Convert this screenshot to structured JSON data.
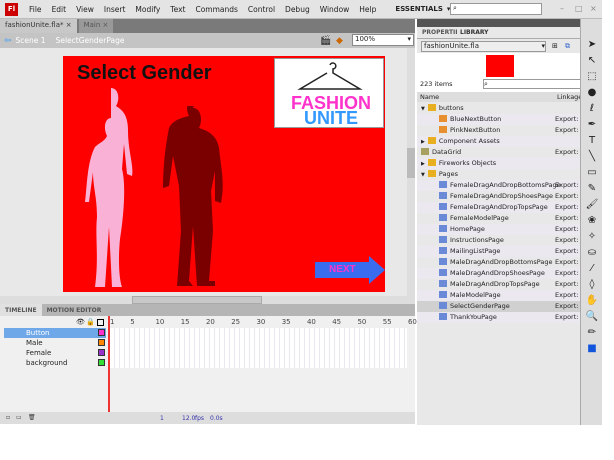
{
  "menubar": {
    "logo": "Fl",
    "items": [
      "File",
      "Edit",
      "View",
      "Insert",
      "Modify",
      "Text",
      "Commands",
      "Control",
      "Debug",
      "Window",
      "Help"
    ],
    "workspace": "ESSENTIALS",
    "search_value": ""
  },
  "doc_tabs": [
    {
      "label": "fashionUnite.fla*"
    },
    {
      "label": "Main"
    }
  ],
  "edit_bar": {
    "scene": "Scene 1",
    "symbol": "SelectGenderPage",
    "zoom": "100%"
  },
  "stage": {
    "title": "Select Gender",
    "logo_line1": "FASHION",
    "logo_line2": "UNITE",
    "next_label": "NEXT",
    "background": "#ff0000"
  },
  "timeline": {
    "tabs": [
      "TIMELINE",
      "MOTION EDITOR"
    ],
    "frame_numbers": [
      "1",
      "5",
      "10",
      "15",
      "20",
      "25",
      "30",
      "35",
      "40",
      "45",
      "50",
      "55",
      "60"
    ],
    "layers": [
      {
        "name": "Button",
        "color": "#ff33cc"
      },
      {
        "name": "Male",
        "color": "#ff8800"
      },
      {
        "name": "Female",
        "color": "#9933cc"
      },
      {
        "name": "background",
        "color": "#33dd33"
      }
    ],
    "current_frame": "1",
    "fps": "12.0",
    "fps_unit": "fps",
    "time": "0.0s"
  },
  "library": {
    "tabs": [
      "PROPERTIES",
      "LIBRARY"
    ],
    "file": "fashionUnite.fla",
    "count": "223 items",
    "columns": [
      "Name",
      "Linkage"
    ],
    "items": [
      {
        "name": "buttons",
        "type": "folder-open",
        "indent": 0,
        "link": ""
      },
      {
        "name": "BlueNextButton",
        "type": "button",
        "indent": 1,
        "link": "Export: I"
      },
      {
        "name": "PinkNextButton",
        "type": "button",
        "indent": 1,
        "link": "Export: I"
      },
      {
        "name": "Component Assets",
        "type": "folder",
        "indent": 0,
        "link": ""
      },
      {
        "name": "DataGrid",
        "type": "component",
        "indent": 0,
        "link": "Export: I"
      },
      {
        "name": "Fireworks Objects",
        "type": "folder",
        "indent": 0,
        "link": ""
      },
      {
        "name": "Pages",
        "type": "folder-open",
        "indent": 0,
        "link": ""
      },
      {
        "name": "FemaleDragAndDropBottomsPage",
        "type": "movieclip",
        "indent": 1,
        "link": "Export: I"
      },
      {
        "name": "FemaleDragAndDropShoesPage",
        "type": "movieclip",
        "indent": 1,
        "link": "Export: I"
      },
      {
        "name": "FemaleDragAndDropTopsPage",
        "type": "movieclip",
        "indent": 1,
        "link": "Export: I"
      },
      {
        "name": "FemaleModelPage",
        "type": "movieclip",
        "indent": 1,
        "link": "Export: I"
      },
      {
        "name": "HomePage",
        "type": "movieclip",
        "indent": 1,
        "link": "Export: I"
      },
      {
        "name": "InstructionsPage",
        "type": "movieclip",
        "indent": 1,
        "link": "Export: I"
      },
      {
        "name": "MailingListPage",
        "type": "movieclip",
        "indent": 1,
        "link": "Export: I"
      },
      {
        "name": "MaleDragAndDropBottomsPage",
        "type": "movieclip",
        "indent": 1,
        "link": "Export: I"
      },
      {
        "name": "MaleDragAndDropShoesPage",
        "type": "movieclip",
        "indent": 1,
        "link": "Export: I"
      },
      {
        "name": "MaleDragAndDropTopsPage",
        "type": "movieclip",
        "indent": 1,
        "link": "Export: I"
      },
      {
        "name": "MaleModelPage",
        "type": "movieclip",
        "indent": 1,
        "link": "Export: I"
      },
      {
        "name": "SelectGenderPage",
        "type": "movieclip",
        "indent": 1,
        "link": "Export: I",
        "selected": true
      },
      {
        "name": "ThankYouPage",
        "type": "movieclip",
        "indent": 1,
        "link": "Export: I"
      }
    ]
  },
  "tools": [
    "selection",
    "subselection",
    "free-transform",
    "3d-rotation",
    "lasso",
    "pen",
    "text",
    "line",
    "rectangle",
    "pencil",
    "brush",
    "deco",
    "bone",
    "paint-bucket",
    "eyedropper",
    "eraser",
    "hand",
    "zoom",
    "stroke-color",
    "fill-color"
  ]
}
